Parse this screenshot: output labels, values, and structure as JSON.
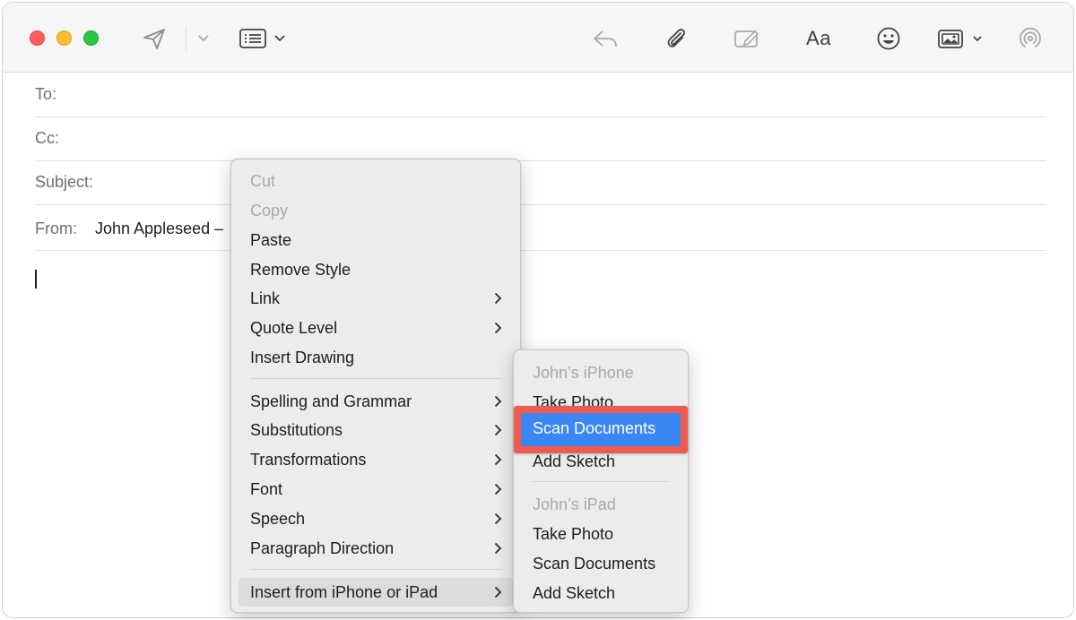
{
  "toolbar": {
    "send_icon": "paper-plane-icon",
    "header_fields_icon": "header-fields-icon",
    "reply_icon": "reply-icon",
    "attach_icon": "paperclip-icon",
    "markup_icon": "markup-icon",
    "format_label": "Aa",
    "emoji_icon": "smiley-icon",
    "photo_icon": "photo-browser-icon",
    "airdrop_icon": "airdrop-icon"
  },
  "compose": {
    "to_label": "To:",
    "cc_label": "Cc:",
    "subject_label": "Subject:",
    "from_label": "From:",
    "from_value": "John Appleseed –"
  },
  "context_menu": {
    "items": [
      {
        "label": "Cut",
        "enabled": false
      },
      {
        "label": "Copy",
        "enabled": false
      },
      {
        "label": "Paste",
        "enabled": true
      },
      {
        "label": "Remove Style",
        "enabled": true
      },
      {
        "label": "Link",
        "enabled": true,
        "submenu": true
      },
      {
        "label": "Quote Level",
        "enabled": true,
        "submenu": true
      },
      {
        "label": "Insert Drawing",
        "enabled": true
      },
      {
        "label": "Spelling and Grammar",
        "enabled": true,
        "submenu": true
      },
      {
        "label": "Substitutions",
        "enabled": true,
        "submenu": true
      },
      {
        "label": "Transformations",
        "enabled": true,
        "submenu": true
      },
      {
        "label": "Font",
        "enabled": true,
        "submenu": true
      },
      {
        "label": "Speech",
        "enabled": true,
        "submenu": true
      },
      {
        "label": "Paragraph Direction",
        "enabled": true,
        "submenu": true
      },
      {
        "label": "Insert from iPhone or iPad",
        "enabled": true,
        "submenu": true
      }
    ]
  },
  "submenu": {
    "iphone_header": "John’s iPhone",
    "iphone_items": [
      "Take Photo",
      "Scan Documents",
      "Add Sketch"
    ],
    "ipad_header": "John’s iPad",
    "ipad_items": [
      "Take Photo",
      "Scan Documents",
      "Add Sketch"
    ],
    "selected": "Scan Documents"
  },
  "colors": {
    "highlight_blue": "#3a86f2",
    "callout_red": "#ef5a4f",
    "close": "#ff5f57",
    "minimize": "#febc2e",
    "zoom": "#28c840"
  }
}
